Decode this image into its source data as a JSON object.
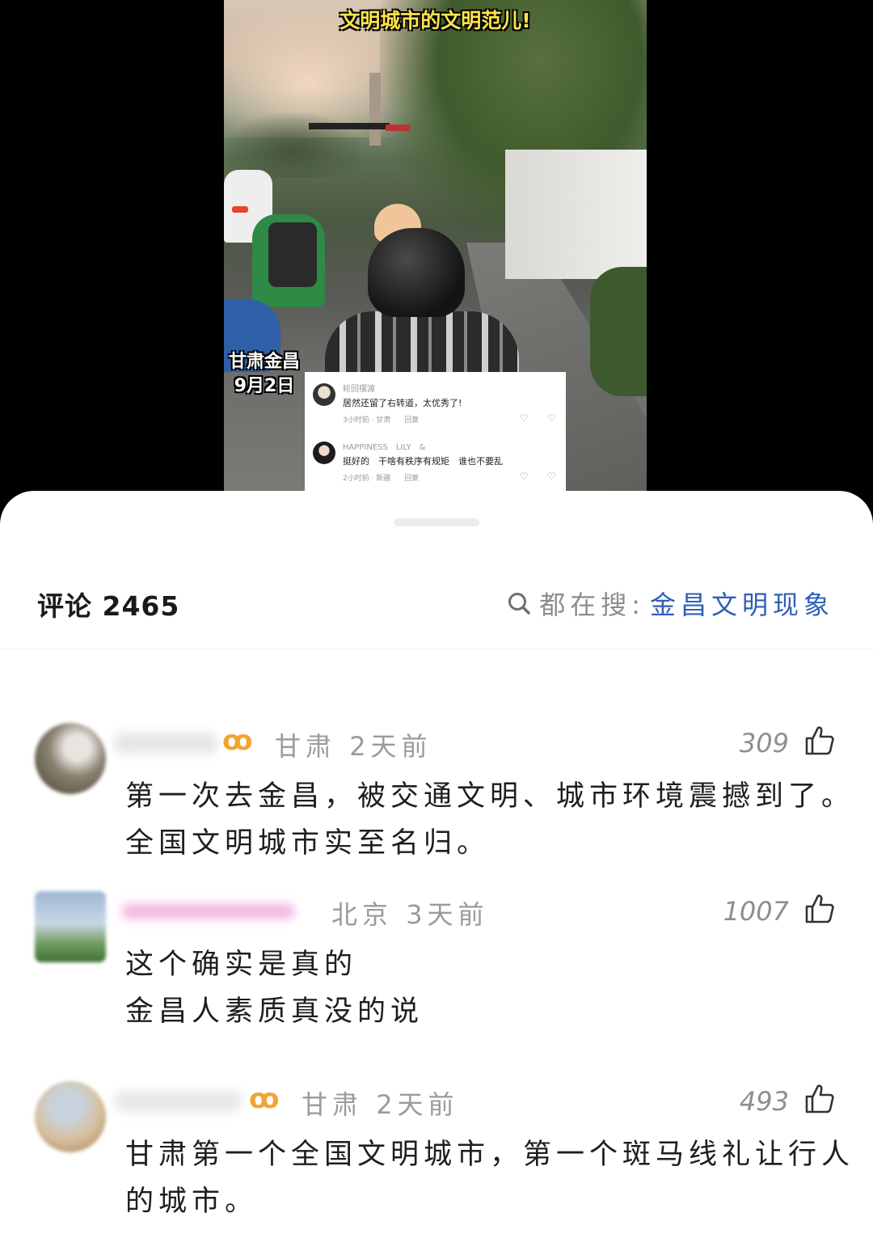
{
  "video": {
    "title": "文明城市的文明范儿!",
    "location": "甘肃金昌",
    "date": "9月2日",
    "overlay_comments": [
      {
        "name": "轮回摆渡",
        "text": "居然还留了右转道，太优秀了!",
        "time": "3小时前 · 甘肃",
        "reply": "回复"
      },
      {
        "name": "HAPPINESS　LILY　&",
        "text": "挺好的　干啥有秩序有规矩　谁也不要乱",
        "time": "2小时前 · 新疆",
        "reply": "回复"
      }
    ]
  },
  "comments_header": {
    "title": "评论 2465",
    "search_label": "都在搜:",
    "search_term": "金昌文明现象"
  },
  "comments": [
    {
      "badge": "ꝏ",
      "location": "甘肃",
      "time": "2天前",
      "likes": "309",
      "lines": [
        "第一次去金昌，被交通文明、城市环境震撼到了。",
        "全国文明城市实至名归。"
      ]
    },
    {
      "badge": "",
      "location": "北京",
      "time": "3天前",
      "likes": "1007",
      "lines": [
        "这个确实是真的",
        "金昌人素质真没的说"
      ]
    },
    {
      "badge": "ꝏ",
      "location": "甘肃",
      "time": "2天前",
      "likes": "493",
      "lines": [
        "甘肃第一个全国文明城市，第一个斑马线礼让行人",
        "的城市。"
      ]
    }
  ],
  "colors": {
    "accent_search": "#2f5fb6",
    "badge": "#f2a534",
    "title_yellow": "#ffe34a"
  },
  "icons": {
    "search": "search-icon",
    "like": "thumbs-up-icon",
    "heart": "heart-icon",
    "dislike": "broken-heart-icon"
  }
}
